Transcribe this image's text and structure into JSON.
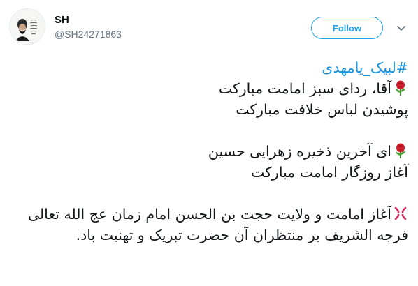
{
  "user": {
    "name": "SH",
    "handle": "@SH24271863"
  },
  "follow_label": "Follow",
  "tweet": {
    "hashtag": "#لبیک_یامهدی",
    "para1_line1": "آقا، ردای سبز امامت مبارکت",
    "para1_line2": "پوشیدن لباس خلافت مبارکت",
    "para2_line1": "ای آخرین ذخیره زهرایی حسین",
    "para2_line2": "آغاز روزگار امامت مبارکت",
    "para3": "آغاز امامت و ولایت حجت بن الحسن امام زمان عج الله تعالی فرجه الشریف بر منتظران آن حضرت تبریک و تهنیت باد."
  },
  "icons": {
    "para1": "rose-icon",
    "para2": "rose-icon",
    "para3": "anger-symbol-icon"
  },
  "colors": {
    "link": "#1b95e0",
    "follow": "#1da1f2",
    "handle": "#657786",
    "text": "#14171a"
  }
}
